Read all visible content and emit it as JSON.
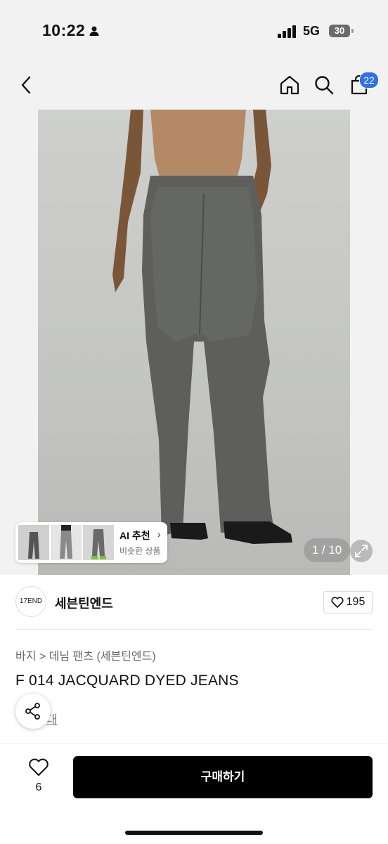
{
  "status": {
    "time": "10:22",
    "network": "5G",
    "battery": "30"
  },
  "header": {
    "cart_count": "22"
  },
  "gallery": {
    "counter": "1 / 10",
    "ai_title": "AI 추천",
    "ai_subtitle": "비슷한 상품"
  },
  "brand": {
    "logo_text": "17END",
    "name": "세븐틴엔드",
    "likes": "195"
  },
  "product": {
    "breadcrumb": "바지 > 데님 팬츠 (세븐틴엔드)",
    "title": "F 014 JACQUARD DYED JEANS",
    "sub_link": "대"
  },
  "bottom": {
    "wishlist_count": "6",
    "buy_label": "구매하기"
  }
}
